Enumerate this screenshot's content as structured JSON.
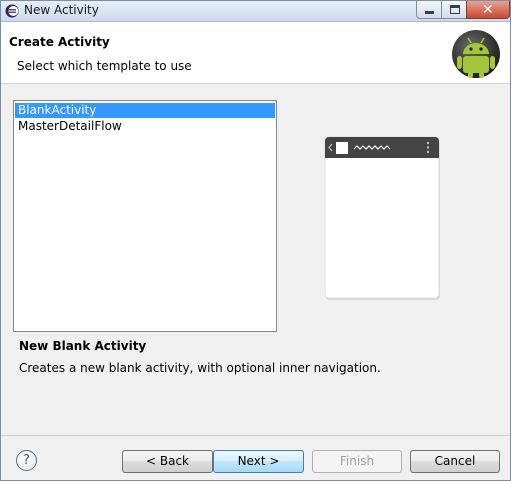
{
  "window": {
    "title": "New Activity"
  },
  "header": {
    "title": "Create Activity",
    "subtitle": "Select which template to use",
    "logo_icon": "android-logo-icon"
  },
  "templates": {
    "items": [
      {
        "label": "BlankActivity",
        "selected": true
      },
      {
        "label": "MasterDetailFlow",
        "selected": false
      }
    ]
  },
  "description": {
    "title": "New Blank Activity",
    "text": "Creates a new blank activity, with optional inner navigation."
  },
  "footer": {
    "help_label": "?",
    "back_label": "< Back",
    "next_label": "Next >",
    "finish_label": "Finish",
    "cancel_label": "Cancel"
  },
  "colors": {
    "selection": "#3399ff",
    "android_green": "#a4c639"
  }
}
